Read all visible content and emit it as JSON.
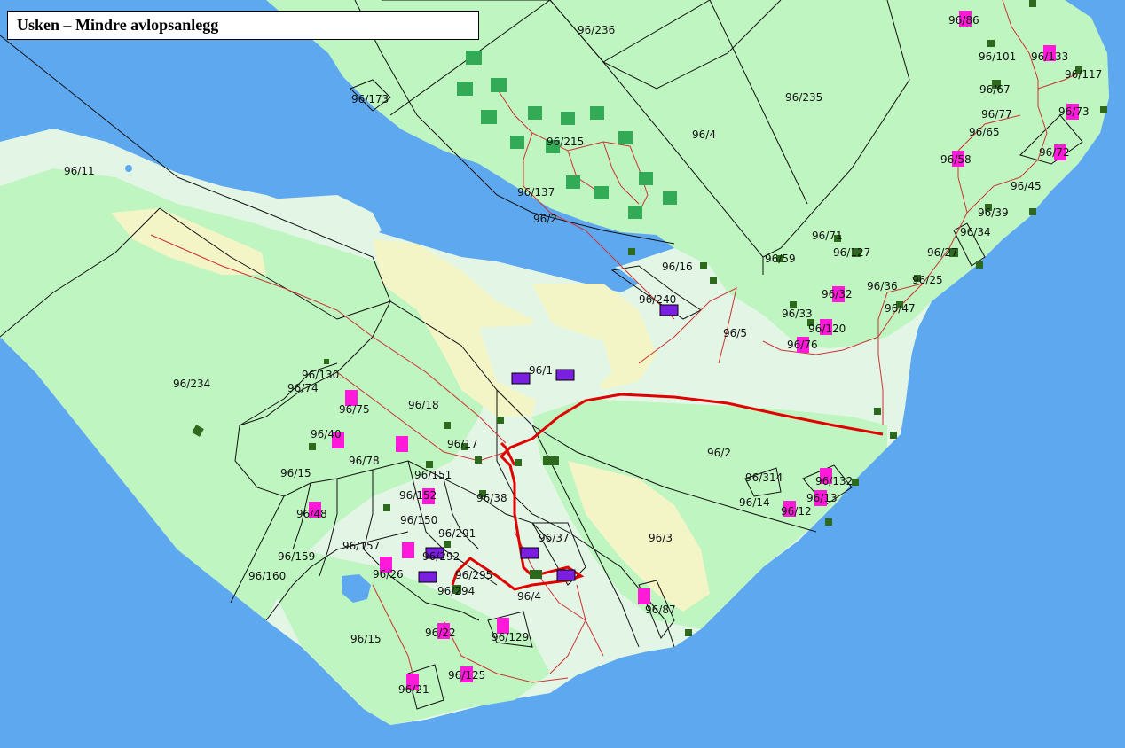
{
  "title": "Usken – Mindre avlopsanlegg",
  "colors": {
    "sea": "#5ea8f0",
    "land_light": "#e3f6e6",
    "land_green": "#bff5c0",
    "field": "#f4f5c6",
    "boundary": "#000000",
    "pipe_main": "#e10000",
    "pipe_small": "#cc3333",
    "building": "#2d6a1d",
    "cabin": "#33aa55",
    "marker_pink": "#ff19d8",
    "marker_purple": "#7a1fe0"
  },
  "parcels": [
    "96/236",
    "96/235",
    "96/173",
    "96/4",
    "96/11",
    "96/215",
    "96/137",
    "96/2",
    "96/86",
    "96/101",
    "96/133",
    "96/117",
    "96/67",
    "96/73",
    "96/77",
    "96/65",
    "96/72",
    "96/58",
    "96/45",
    "96/39",
    "96/34",
    "96/71",
    "96/27",
    "96/127",
    "96/59",
    "96/16",
    "96/25",
    "96/36",
    "96/32",
    "96/240",
    "96/47",
    "96/33",
    "96/120",
    "96/5",
    "96/76",
    "96/1",
    "96/234",
    "96/130",
    "96/74",
    "96/75",
    "96/18",
    "96/40",
    "96/17",
    "96/78",
    "96/15",
    "96/151",
    "96/152",
    "96/38",
    "96/48",
    "96/150",
    "96/291",
    "96/37",
    "96/157",
    "96/159",
    "96/292",
    "96/160",
    "96/26",
    "96/295",
    "96/294",
    "96/4",
    "96/3",
    "96/87",
    "96/22",
    "96/129",
    "96/15",
    "96/125",
    "96/21",
    "96/2",
    "96/314",
    "96/132",
    "96/14",
    "96/13",
    "96/12"
  ]
}
